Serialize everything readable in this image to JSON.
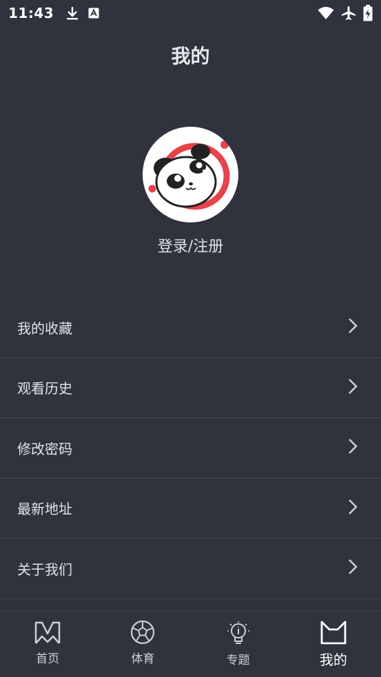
{
  "status_bar": {
    "time": "11:43",
    "left_icons": [
      "download-icon",
      "app-notification-icon"
    ],
    "right_icons": [
      "wifi-icon",
      "airplane-mode-icon",
      "battery-charging-icon"
    ]
  },
  "header": {
    "title": "我的"
  },
  "profile": {
    "avatar_icon": "panda-avatar-icon",
    "login_label": "登录/注册"
  },
  "menu": {
    "items": [
      {
        "label": "我的收藏"
      },
      {
        "label": "观看历史"
      },
      {
        "label": "修改密码"
      },
      {
        "label": "最新地址"
      },
      {
        "label": "关于我们"
      }
    ]
  },
  "tab_bar": {
    "tabs": [
      {
        "label": "首页",
        "icon": "m-logo-icon"
      },
      {
        "label": "体育",
        "icon": "soccer-ball-icon"
      },
      {
        "label": "专题",
        "icon": "lightbulb-icon"
      },
      {
        "label": "我的",
        "icon": "cat-ears-icon",
        "active": true
      }
    ]
  },
  "colors": {
    "background": "#30333e",
    "divider": "#474a55",
    "accent_red": "#e8424a"
  }
}
